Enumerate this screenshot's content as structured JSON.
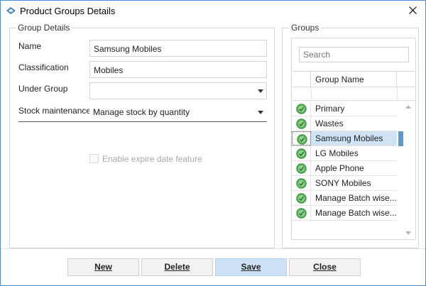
{
  "window": {
    "title": "Product Groups Details"
  },
  "group_details": {
    "legend": "Group Details",
    "name_label": "Name",
    "name_value": "Samsung Mobiles",
    "classification_label": "Classification",
    "classification_value": "Mobiles",
    "under_group_label": "Under Group",
    "under_group_value": "",
    "stock_label": "Stock maintenance",
    "stock_value": "Manage stock by quantity",
    "expire_label": "Enable expire date feature",
    "expire_checked": false
  },
  "groups": {
    "legend": "Groups",
    "search_placeholder": "Search",
    "column_header": "Group Name",
    "rows": [
      {
        "name": "Primary",
        "selected": false
      },
      {
        "name": "Wastes",
        "selected": false
      },
      {
        "name": "Samsung Mobiles",
        "selected": true
      },
      {
        "name": "LG Mobiles",
        "selected": false
      },
      {
        "name": "Apple Phone",
        "selected": false
      },
      {
        "name": "SONY Mobiles",
        "selected": false
      },
      {
        "name": "Manage Batch wise...",
        "selected": false
      },
      {
        "name": "Manage Batch wise...",
        "selected": false
      }
    ]
  },
  "buttons": {
    "new": "New",
    "delete": "Delete",
    "save": "Save",
    "close": "Close"
  },
  "colors": {
    "accent": "#4d8bd6",
    "selected_row": "#cfe3f5",
    "primary_button": "#cde2f7",
    "ok_icon": "#4caf50"
  }
}
